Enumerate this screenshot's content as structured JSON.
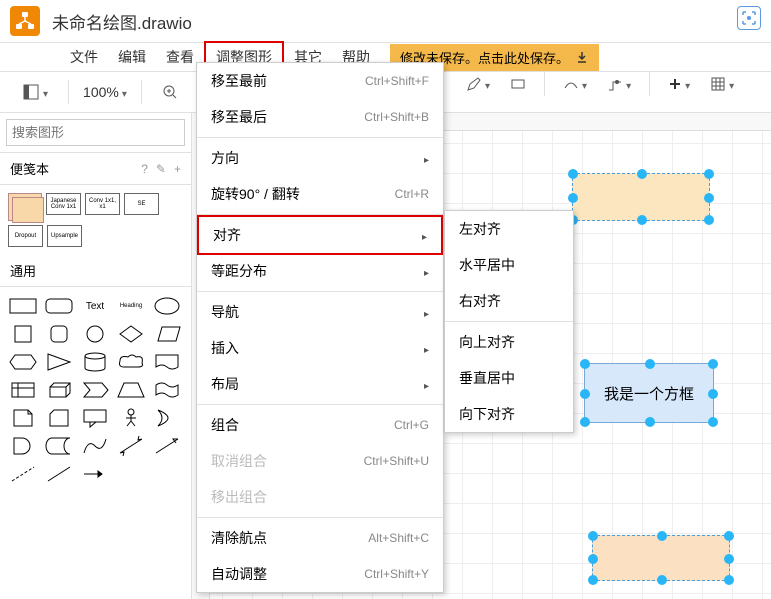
{
  "header": {
    "title": "未命名绘图.drawio"
  },
  "menubar": {
    "items": [
      "文件",
      "编辑",
      "查看",
      "调整图形",
      "其它",
      "帮助"
    ],
    "save_notice": "修改未保存。点击此处保存。"
  },
  "toolbar": {
    "zoom": "100%"
  },
  "sidebar": {
    "search_placeholder": "搜索图形",
    "scratch_label": "便笺本",
    "scratch_boxes": [
      "Japanese Conv 1x1",
      "Conv 1x1, x1",
      "SE",
      "Dropout",
      "Upsample"
    ],
    "general_label": "通用",
    "text_label": "Text",
    "heading_label": "Heading"
  },
  "dropdown": {
    "items": [
      {
        "label": "移至最前",
        "shortcut": "Ctrl+Shift+F"
      },
      {
        "label": "移至最后",
        "shortcut": "Ctrl+Shift+B"
      },
      {
        "sep": true
      },
      {
        "label": "方向",
        "submenu": true
      },
      {
        "label": "旋转90° / 翻转",
        "shortcut": "Ctrl+R"
      },
      {
        "sep": true
      },
      {
        "label": "对齐",
        "submenu": true,
        "hl": true
      },
      {
        "label": "等距分布",
        "submenu": true
      },
      {
        "sep": true
      },
      {
        "label": "导航",
        "submenu": true
      },
      {
        "label": "插入",
        "submenu": true
      },
      {
        "label": "布局",
        "submenu": true
      },
      {
        "sep": true
      },
      {
        "label": "组合",
        "shortcut": "Ctrl+G"
      },
      {
        "label": "取消组合",
        "shortcut": "Ctrl+Shift+U",
        "disabled": true
      },
      {
        "label": "移出组合",
        "disabled": true
      },
      {
        "sep": true
      },
      {
        "label": "清除航点",
        "shortcut": "Alt+Shift+C"
      },
      {
        "label": "自动调整",
        "shortcut": "Ctrl+Shift+Y"
      }
    ]
  },
  "submenu": {
    "items": [
      "左对齐",
      "水平居中",
      "右对齐",
      "",
      "向上对齐",
      "垂直居中",
      "向下对齐"
    ]
  },
  "canvas": {
    "shape2_text": "我是一个方框"
  }
}
